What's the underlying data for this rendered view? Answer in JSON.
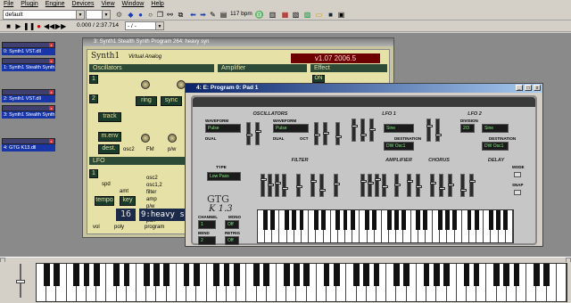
{
  "menu": [
    "File",
    "Plugin",
    "Engine",
    "Devices",
    "View",
    "Window",
    "Help"
  ],
  "toolbar": {
    "preset": "default",
    "tempo": "117 bpm",
    "position": "0.000 / 2:37.714",
    "marker": "- / -"
  },
  "plugins": [
    {
      "name": "0: Synth1 VST.dll"
    },
    {
      "name": "1: Synth1 Stealth Synth"
    },
    {
      "name": "2: Synth1 VST.dll"
    },
    {
      "name": "3: Synth1 Stealth Synth"
    },
    {
      "name": "4: GTG K13.dll"
    }
  ],
  "synth1": {
    "title": "3: Synth1 Stealth Synth Program 264: heavy syn",
    "brand": "Synth1",
    "subtitle": "Virtual Analog",
    "version": "v1.07 2006.5",
    "sections": {
      "osc": "Oscillators",
      "amp": "Amplifier",
      "effect": "Effect",
      "lfo": "LFO"
    },
    "labels": {
      "ring": "ring",
      "sync": "sync",
      "track": "track",
      "menv": "m.env",
      "dest": "dest.",
      "osc2": "osc2",
      "fm": "FM",
      "pw": "p/w",
      "spd": "spd",
      "amt": "amt",
      "tempo": "tempo",
      "key": "key",
      "filter": "filter",
      "vol": "vol",
      "poly": "poly",
      "program": "program"
    },
    "program_num": "16",
    "program_name": "9:heavy s"
  },
  "gtg": {
    "title": "4: E: Program 0: Pad 1",
    "sections": {
      "osc": "OSCILLATORS",
      "lfo1": "LFO 1",
      "lfo2": "LFO 2",
      "filter": "FILTER",
      "amp": "AMPLIFIER",
      "chorus": "CHORUS",
      "delay": "DELAY"
    },
    "osc1_wave": "Pulse",
    "osc2_wave": "Pulse",
    "lfo1_wave": "Sine",
    "lfo2_div": "2/3",
    "lfo2_wave": "Sine",
    "lfo1_dest": "DW Osc1",
    "lfo2_dest": "DW Osc1",
    "filter_type": "Low Pass",
    "logo": "GTG",
    "model": "K 1.3",
    "channel": "1",
    "mono": "Off",
    "bend": "2",
    "retrig": "Off",
    "labels": {
      "waveform": "WAVEFORM",
      "tune": "TUNE",
      "fine": "FINE",
      "dual": "DUAL",
      "oct": "OCT",
      "type": "TYPE",
      "destination": "DESTINATION",
      "division": "DIVISION",
      "channel": "CHANNEL",
      "mono": "MONO",
      "bend": "BEND",
      "retrig": "RETRIG",
      "mode": "MODE",
      "snap": "SNAP"
    }
  }
}
